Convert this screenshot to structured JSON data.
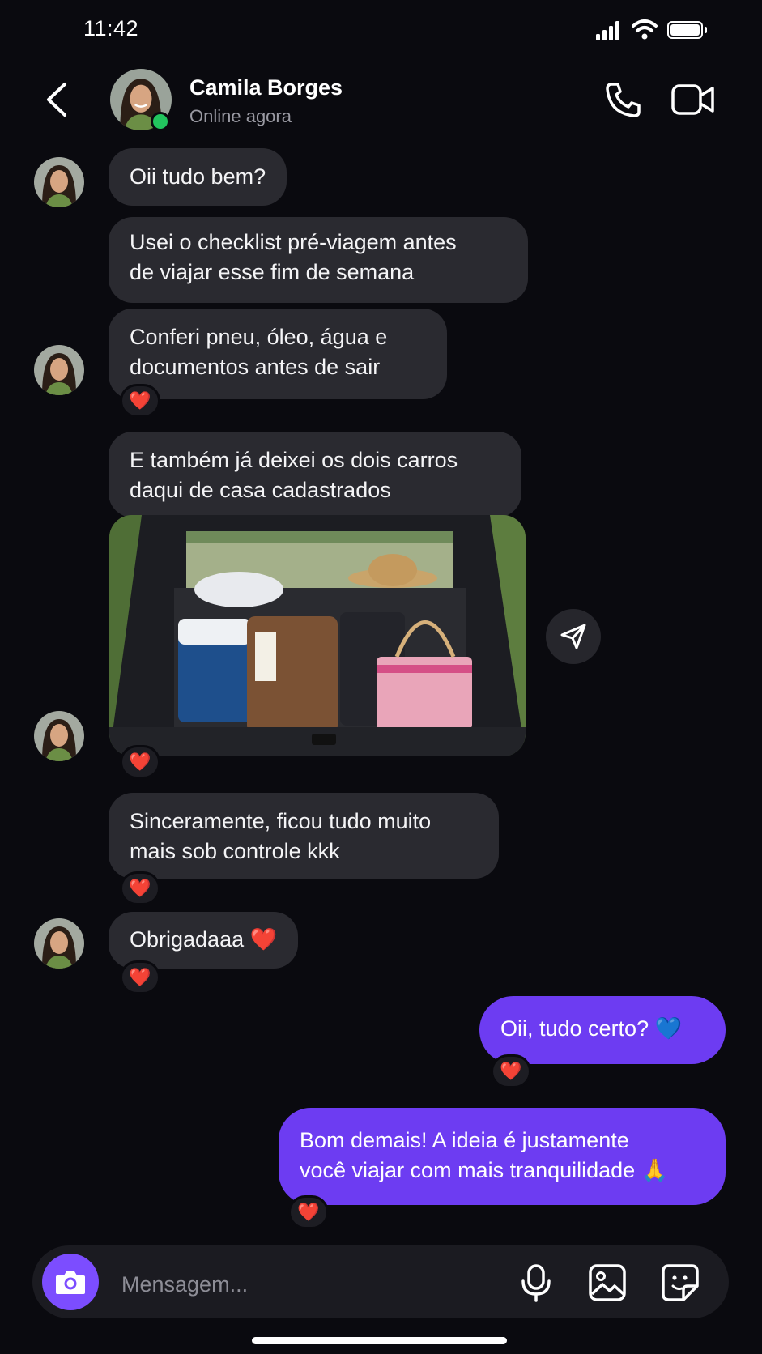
{
  "status_bar": {
    "time": "11:42"
  },
  "header": {
    "name": "Camila Borges",
    "status": "Online agora"
  },
  "messages": [
    {
      "text": "Oii tudo bem?"
    },
    {
      "text": "Usei o checklist pré-viagem antes\nde viajar esse fim de semana"
    },
    {
      "text": "Conferi pneu, óleo, água e\ndocumentos antes de sair",
      "reaction": "❤️"
    },
    {
      "text": "E também já deixei os dois carros\ndaqui de casa cadastrados"
    },
    {
      "image": "car-trunk-with-luggage",
      "reaction": "❤️"
    },
    {
      "text": "Sinceramente, ficou tudo muito\nmais sob controle kkk",
      "reaction": "❤️"
    },
    {
      "text": "Obrigadaaa ❤️",
      "reaction": "❤️"
    },
    {
      "text": "Oii, tudo certo? 💙",
      "reaction": "❤️"
    },
    {
      "text": "Bom demais! A ideia é justamente\nvocê viajar com mais tranquilidade 🙏",
      "reaction": "❤️"
    }
  ],
  "composer": {
    "placeholder": "Mensagem..."
  },
  "colors": {
    "background": "#0a0a0f",
    "incoming_bubble": "#2a2a30",
    "outgoing_bubble": "#6d3cf2",
    "accent": "#7c4dff",
    "online": "#22c55e"
  },
  "icons": [
    "back-chevron-icon",
    "phone-icon",
    "video-camera-icon",
    "send-icon",
    "camera-icon",
    "microphone-icon",
    "gallery-icon",
    "sticker-icon"
  ]
}
